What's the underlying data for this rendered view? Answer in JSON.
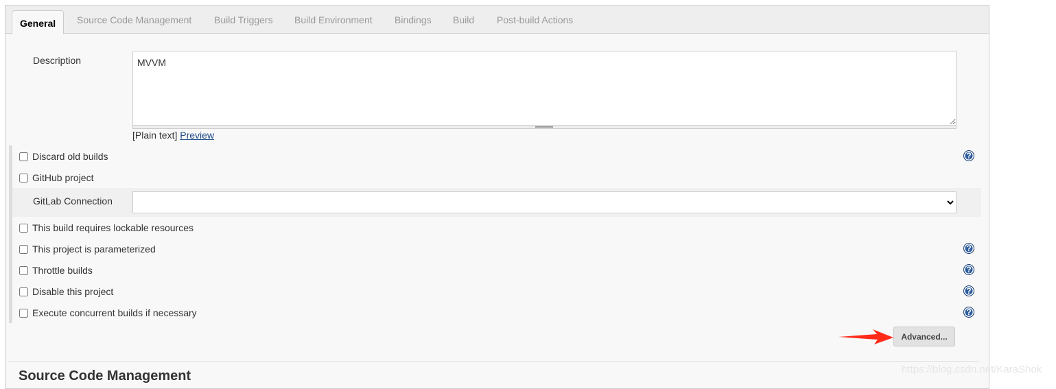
{
  "tabs": [
    {
      "label": "General",
      "active": true
    },
    {
      "label": "Source Code Management"
    },
    {
      "label": "Build Triggers"
    },
    {
      "label": "Build Environment"
    },
    {
      "label": "Bindings"
    },
    {
      "label": "Build"
    },
    {
      "label": "Post-build Actions"
    }
  ],
  "description": {
    "label": "Description",
    "value": "MVVM",
    "format": "[Plain text]",
    "preview_link": "Preview"
  },
  "options": [
    {
      "label": "Discard old builds",
      "checked": false,
      "help": true
    },
    {
      "label": "GitHub project",
      "checked": false,
      "help": false
    },
    {
      "label": "This build requires lockable resources",
      "checked": false,
      "help": false
    },
    {
      "label": "This project is parameterized",
      "checked": false,
      "help": true
    },
    {
      "label": "Throttle builds",
      "checked": false,
      "help": true
    },
    {
      "label": "Disable this project",
      "checked": false,
      "help": true
    },
    {
      "label": "Execute concurrent builds if necessary",
      "checked": false,
      "help": true
    }
  ],
  "gitlab": {
    "label": "GitLab Connection",
    "value": ""
  },
  "help_icon": "question-circle-icon",
  "advanced_button": "Advanced...",
  "annotation": {
    "icon": "red-arrow",
    "color": "#ff2a1a"
  },
  "section_heading": "Source Code Management",
  "watermark": "https://blog.csdn.net/KaraShok"
}
